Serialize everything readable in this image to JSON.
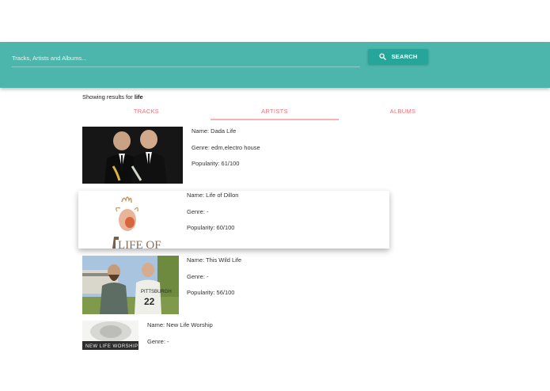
{
  "header": {
    "search_placeholder": "Tracks, Artists and Albums...",
    "search_button_label": "SEARCH",
    "accent_color": "#4db6ac",
    "button_color": "#26a69a"
  },
  "results": {
    "prefix": "Showing results for ",
    "query": "life"
  },
  "tabs": [
    {
      "label": "TRACKS"
    },
    {
      "label": "ARTISTS",
      "active": true
    },
    {
      "label": "ALBUMS"
    }
  ],
  "artists": [
    {
      "name": "Name: Dada Life",
      "genre": "Genre: edm,electro house",
      "popularity": "Popularity: 61/100"
    },
    {
      "name": "Name: Life of Dillon",
      "genre": "Genre: -",
      "popularity": "Popularity: 60/100"
    },
    {
      "name": "Name: This Wild Life",
      "genre": "Genre: -",
      "popularity": "Popularity: 56/100"
    },
    {
      "name": "Name: New Life Worship",
      "genre": "Genre: -"
    }
  ]
}
